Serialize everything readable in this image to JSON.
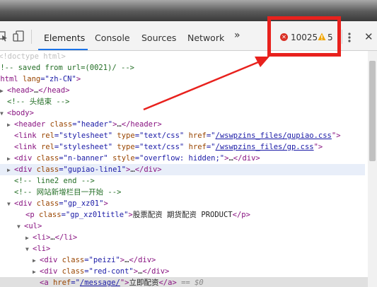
{
  "toolbar": {
    "tabs": [
      {
        "label": "Elements",
        "active": true
      },
      {
        "label": "Console",
        "active": false
      },
      {
        "label": "Sources",
        "active": false
      },
      {
        "label": "Network",
        "active": false
      }
    ],
    "more_tabs": "»",
    "error_count": "10025",
    "warning_count": "5",
    "close": "✕",
    "icons": [
      "inspect-icon",
      "device-toggle-icon",
      "error-icon",
      "warning-icon",
      "kebab-menu-icon",
      "close-icon"
    ]
  },
  "colors": {
    "annotation_red": "#e8211d",
    "tab_underline": "#1a73e8",
    "error": "#d93025",
    "warning": "#f2a600"
  },
  "dom": {
    "l0": "<!doctype html>",
    "l1": "<!-- saved from url=(0021)/ -->",
    "l2a": "<html ",
    "l2b": "lang",
    "l2c": "=\"zh-CN\"",
    "l2d": ">",
    "l3a": "<head>",
    "l3b": "…",
    "l3c": "</head>",
    "l4": "<!-- 头结束 -->",
    "l5": "<body>",
    "l6a": "<header ",
    "l6b": "class",
    "l6c": "=\"header\"",
    "l6d": ">",
    "l6e": "…",
    "l6f": "</header>",
    "l7a": "<link ",
    "l7b": "rel",
    "l7c": "=\"stylesheet\"",
    "l7d": " type",
    "l7e": "=\"text/css\"",
    "l7f": " href",
    "l7g": "=\"",
    "l7h": "/wswpzins_files/gupiao.css",
    "l7i": "\">",
    "l8a": "<link ",
    "l8b": "rel",
    "l8c": "=\"stylesheet\"",
    "l8d": " type",
    "l8e": "=\"text/css\"",
    "l8f": " href",
    "l8g": "=\"",
    "l8h": "/wswpzins_files/gp.css",
    "l8i": "\">",
    "l9a": "<div ",
    "l9b": "class",
    "l9c": "=\"n-banner\"",
    "l9d": " style",
    "l9e": "=\"overflow: hidden;\"",
    "l9f": ">",
    "l9g": "…",
    "l9h": "</div>",
    "l10a": "<div ",
    "l10b": "class",
    "l10c": "=\"gupiao-line1\"",
    "l10d": ">",
    "l10e": "…",
    "l10f": "</div>",
    "l11": "<!-- line2 end -->",
    "l12": "<!-- 网站新增栏目一开始 -->",
    "l13a": "<div ",
    "l13b": "class",
    "l13c": "=\"gp_xz01\"",
    "l13d": ">",
    "l14a": "<p ",
    "l14b": "class",
    "l14c": "=\"gp_xz01title\"",
    "l14d": ">",
    "l14e": "股票配资 期货配资 PRODUCT",
    "l14f": "</p>",
    "l15": "<ul>",
    "l16a": "<li>",
    "l16b": "…",
    "l16c": "</li>",
    "l17": "<li>",
    "l18a": "<div ",
    "l18b": "class",
    "l18c": "=\"peizi\"",
    "l18d": ">",
    "l18e": "…",
    "l18f": "</div>",
    "l19a": "<div ",
    "l19b": "class",
    "l19c": "=\"red-cont\"",
    "l19d": ">",
    "l19e": "…",
    "l19f": "</div>",
    "l20a": "<a ",
    "l20b": "href",
    "l20c": "=\"",
    "l20d": "/message/",
    "l20e": "\">",
    "l20f": "立即配资",
    "l20g": "</a>",
    "l20h": " == $0"
  }
}
